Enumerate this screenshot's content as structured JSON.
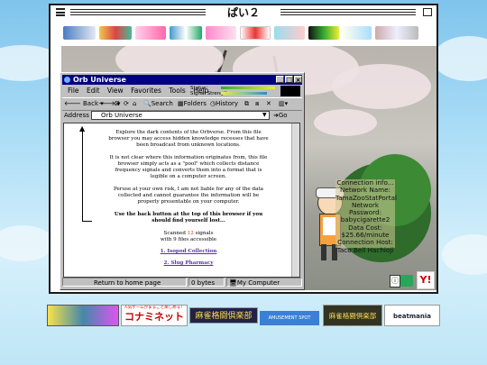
{
  "site": {
    "title": "ぱい２"
  },
  "browser": {
    "title": "Orb Universe",
    "menu": [
      "File",
      "Edit",
      "View",
      "Favorites",
      "Tools",
      "Help"
    ],
    "status_labels": {
      "status": "Status:",
      "signal": "Signal Strength:"
    },
    "signal_level": 0.85,
    "toolbar": {
      "back": "Back",
      "search": "Search",
      "folders": "Folders",
      "history": "History"
    },
    "address_label": "Address",
    "address_value": "Orb Universe",
    "go": "Go",
    "content": {
      "para1": "Explore the dark contents of the Orbverse. From this file browser you may access hidden knowledge recesses that have been broadcast from unknown locations.",
      "para2": "It is not clear where this information originates from, this file browser simply acts as a \"pool\" which collects distance frequency signals and converts them into a format that is legible on a computer screen.",
      "para3": "Peruse at your own risk, I am not liable for any of the data collected and cannot guarantee the information will be properly presentable on your computer.",
      "para4": "Use the back button at the top of this browser if you should find yourself lost...",
      "scanned_prefix": "Scanned",
      "scanned_count": "12",
      "scanned_suffix": "signals",
      "files_line": "with 9 files accessible",
      "link1": "1. Isopod Collection",
      "link2": "2. Slug Pharmacy"
    },
    "statusbar": {
      "left": "Return to home page",
      "size": "0 bytes",
      "zone": "My Computer"
    }
  },
  "connection": {
    "lines": [
      "Connection info...",
      "Network Name:",
      "TamaZooStatPortal",
      "Network Password:",
      "babycigarette2",
      "Data Cost:",
      "$25.66/minute",
      "Connection Host:",
      "Taco Bell Hachioji"
    ]
  },
  "bottom_banners": {
    "b2": "人気ゲームがまるごと楽しめる！",
    "b2_logo": "コナミネットDX",
    "b3": "麻雀格闘倶楽部",
    "b4": "AMUSEMENT SPOT",
    "b5": "麻雀格闘倶楽部",
    "b6": "beatmania IIDX"
  },
  "colors": {
    "accent": "#000080",
    "link": "#5533aa",
    "scanned": "#c0392b"
  }
}
